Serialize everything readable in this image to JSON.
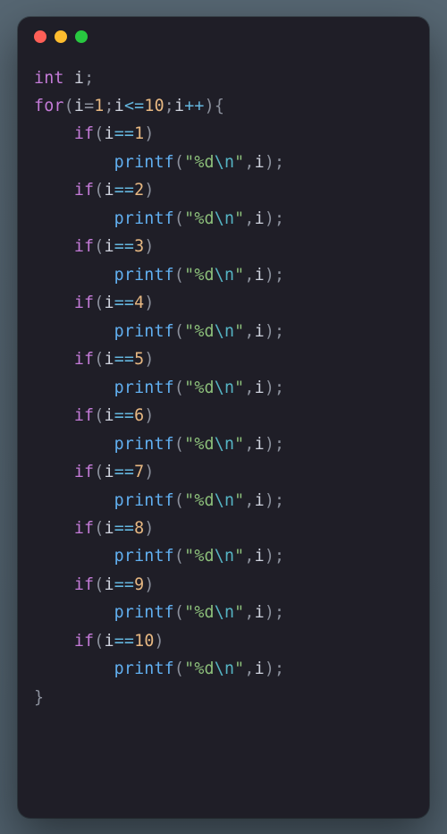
{
  "window_controls": {
    "close": "close",
    "minimize": "minimize",
    "zoom": "zoom"
  },
  "code": {
    "decl_type": "int",
    "decl_var": "i",
    "for_kw": "for",
    "if_kw": "if",
    "printf_fn": "printf",
    "fmt_prefix": "\"%d",
    "fmt_esc": "\\n",
    "fmt_suffix": "\"",
    "loop": {
      "init_var": "i",
      "init_op": "=",
      "init_val": "1",
      "cond_var": "i",
      "cond_op": "<=",
      "cond_val": "10",
      "step_var": "i",
      "step_op": "++"
    },
    "tests": [
      "1",
      "2",
      "3",
      "4",
      "5",
      "6",
      "7",
      "8",
      "9",
      "10"
    ]
  }
}
